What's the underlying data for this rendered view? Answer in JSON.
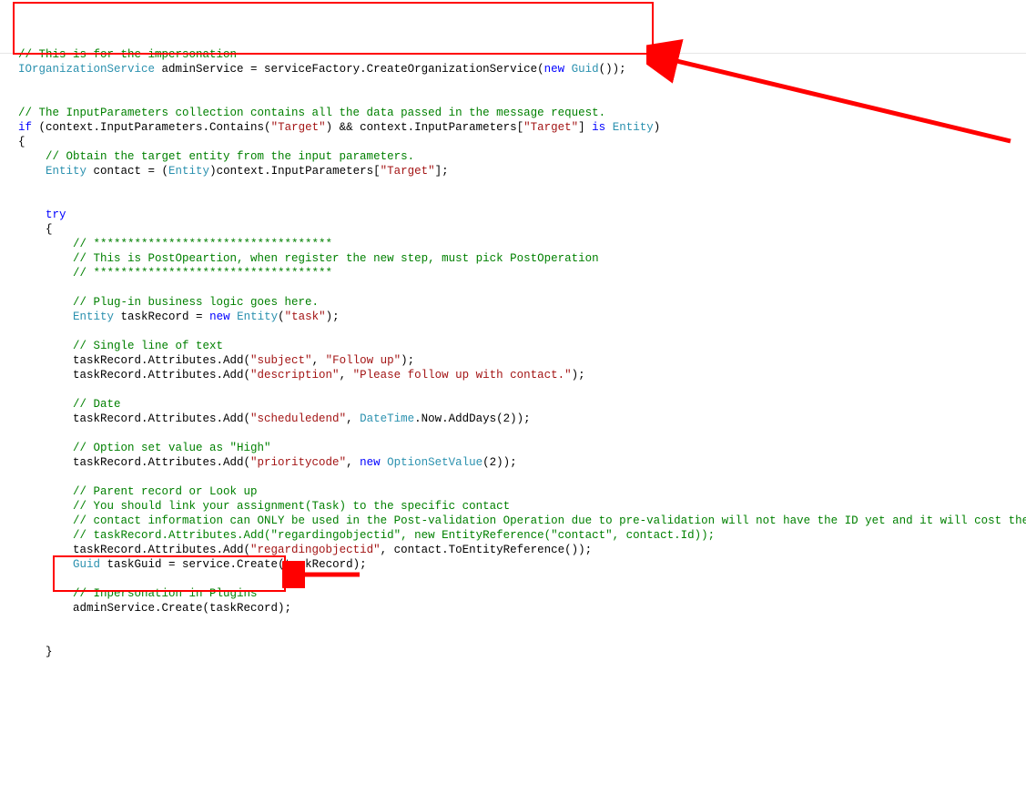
{
  "lines": [
    [
      [
        "comment",
        "// This is for the impersonation"
      ]
    ],
    [
      [
        "type",
        "IOrganizationService"
      ],
      [
        "txt",
        " adminService = serviceFactory.CreateOrganizationService("
      ],
      [
        "kw",
        "new"
      ],
      [
        "txt",
        " "
      ],
      [
        "type",
        "Guid"
      ],
      [
        "txt",
        "());"
      ]
    ],
    [],
    [],
    [
      [
        "comment",
        "// The InputParameters collection contains all the data passed in the message request."
      ]
    ],
    [
      [
        "kw",
        "if"
      ],
      [
        "txt",
        " (context.InputParameters.Contains("
      ],
      [
        "str",
        "\"Target\""
      ],
      [
        "txt",
        ") && context.InputParameters["
      ],
      [
        "str",
        "\"Target\""
      ],
      [
        "txt",
        "] "
      ],
      [
        "kw",
        "is"
      ],
      [
        "txt",
        " "
      ],
      [
        "type",
        "Entity"
      ],
      [
        "txt",
        ")"
      ]
    ],
    [
      [
        "txt",
        "{"
      ]
    ],
    [
      [
        "comment",
        "    // Obtain the target entity from the input parameters."
      ]
    ],
    [
      [
        "txt",
        "    "
      ],
      [
        "type",
        "Entity"
      ],
      [
        "txt",
        " contact = ("
      ],
      [
        "type",
        "Entity"
      ],
      [
        "txt",
        ")context.InputParameters["
      ],
      [
        "str",
        "\"Target\""
      ],
      [
        "txt",
        "];"
      ]
    ],
    [],
    [],
    [
      [
        "txt",
        "    "
      ],
      [
        "kw",
        "try"
      ]
    ],
    [
      [
        "txt",
        "    {"
      ]
    ],
    [
      [
        "comment",
        "        // ***********************************"
      ]
    ],
    [
      [
        "comment",
        "        // This is PostOpeartion, when register the new step, must pick PostOperation"
      ]
    ],
    [
      [
        "comment",
        "        // ***********************************"
      ]
    ],
    [],
    [
      [
        "comment",
        "        // Plug-in business logic goes here."
      ]
    ],
    [
      [
        "txt",
        "        "
      ],
      [
        "type",
        "Entity"
      ],
      [
        "txt",
        " taskRecord = "
      ],
      [
        "kw",
        "new"
      ],
      [
        "txt",
        " "
      ],
      [
        "type",
        "Entity"
      ],
      [
        "txt",
        "("
      ],
      [
        "str",
        "\"task\""
      ],
      [
        "txt",
        ");"
      ]
    ],
    [],
    [
      [
        "comment",
        "        // Single line of text"
      ]
    ],
    [
      [
        "txt",
        "        taskRecord.Attributes.Add("
      ],
      [
        "str",
        "\"subject\""
      ],
      [
        "txt",
        ", "
      ],
      [
        "str",
        "\"Follow up\""
      ],
      [
        "txt",
        ");"
      ]
    ],
    [
      [
        "txt",
        "        taskRecord.Attributes.Add("
      ],
      [
        "str",
        "\"description\""
      ],
      [
        "txt",
        ", "
      ],
      [
        "str",
        "\"Please follow up with contact.\""
      ],
      [
        "txt",
        ");"
      ]
    ],
    [],
    [
      [
        "comment",
        "        // Date"
      ]
    ],
    [
      [
        "txt",
        "        taskRecord.Attributes.Add("
      ],
      [
        "str",
        "\"scheduledend\""
      ],
      [
        "txt",
        ", "
      ],
      [
        "type",
        "DateTime"
      ],
      [
        "txt",
        ".Now.AddDays(2));"
      ]
    ],
    [],
    [
      [
        "comment",
        "        // Option set value as \"High\""
      ]
    ],
    [
      [
        "txt",
        "        taskRecord.Attributes.Add("
      ],
      [
        "str",
        "\"prioritycode\""
      ],
      [
        "txt",
        ", "
      ],
      [
        "kw",
        "new"
      ],
      [
        "txt",
        " "
      ],
      [
        "type",
        "OptionSetValue"
      ],
      [
        "txt",
        "(2));"
      ]
    ],
    [],
    [
      [
        "comment",
        "        // Parent record or Look up"
      ]
    ],
    [
      [
        "comment",
        "        // You should link your assignment(Task) to the specific contact"
      ]
    ],
    [
      [
        "comment",
        "        // contact information can ONLY be used in the Post-validation Operation due to pre-validation will not have the ID yet and it will cost the error."
      ]
    ],
    [
      [
        "comment",
        "        // taskRecord.Attributes.Add(\"regardingobjectid\", new EntityReference(\"contact\", contact.Id));"
      ]
    ],
    [
      [
        "txt",
        "        taskRecord.Attributes.Add("
      ],
      [
        "str",
        "\"regardingobjectid\""
      ],
      [
        "txt",
        ", contact.ToEntityReference());"
      ]
    ],
    [
      [
        "txt",
        "        "
      ],
      [
        "type",
        "Guid"
      ],
      [
        "txt",
        " taskGuid = service.Create(taskRecord);"
      ]
    ],
    [],
    [
      [
        "comment",
        "        // Inpersonation in Plugins"
      ]
    ],
    [
      [
        "txt",
        "        adminService.Create(taskRecord);"
      ]
    ],
    [],
    [],
    [
      [
        "txt",
        "    }"
      ]
    ]
  ],
  "annotations": {
    "box1_label": "impersonation-setup-box",
    "box2_label": "impersonation-call-box",
    "arrow1_label": "arrow-to-impersonation-setup",
    "arrow2_label": "arrow-to-impersonation-call"
  }
}
